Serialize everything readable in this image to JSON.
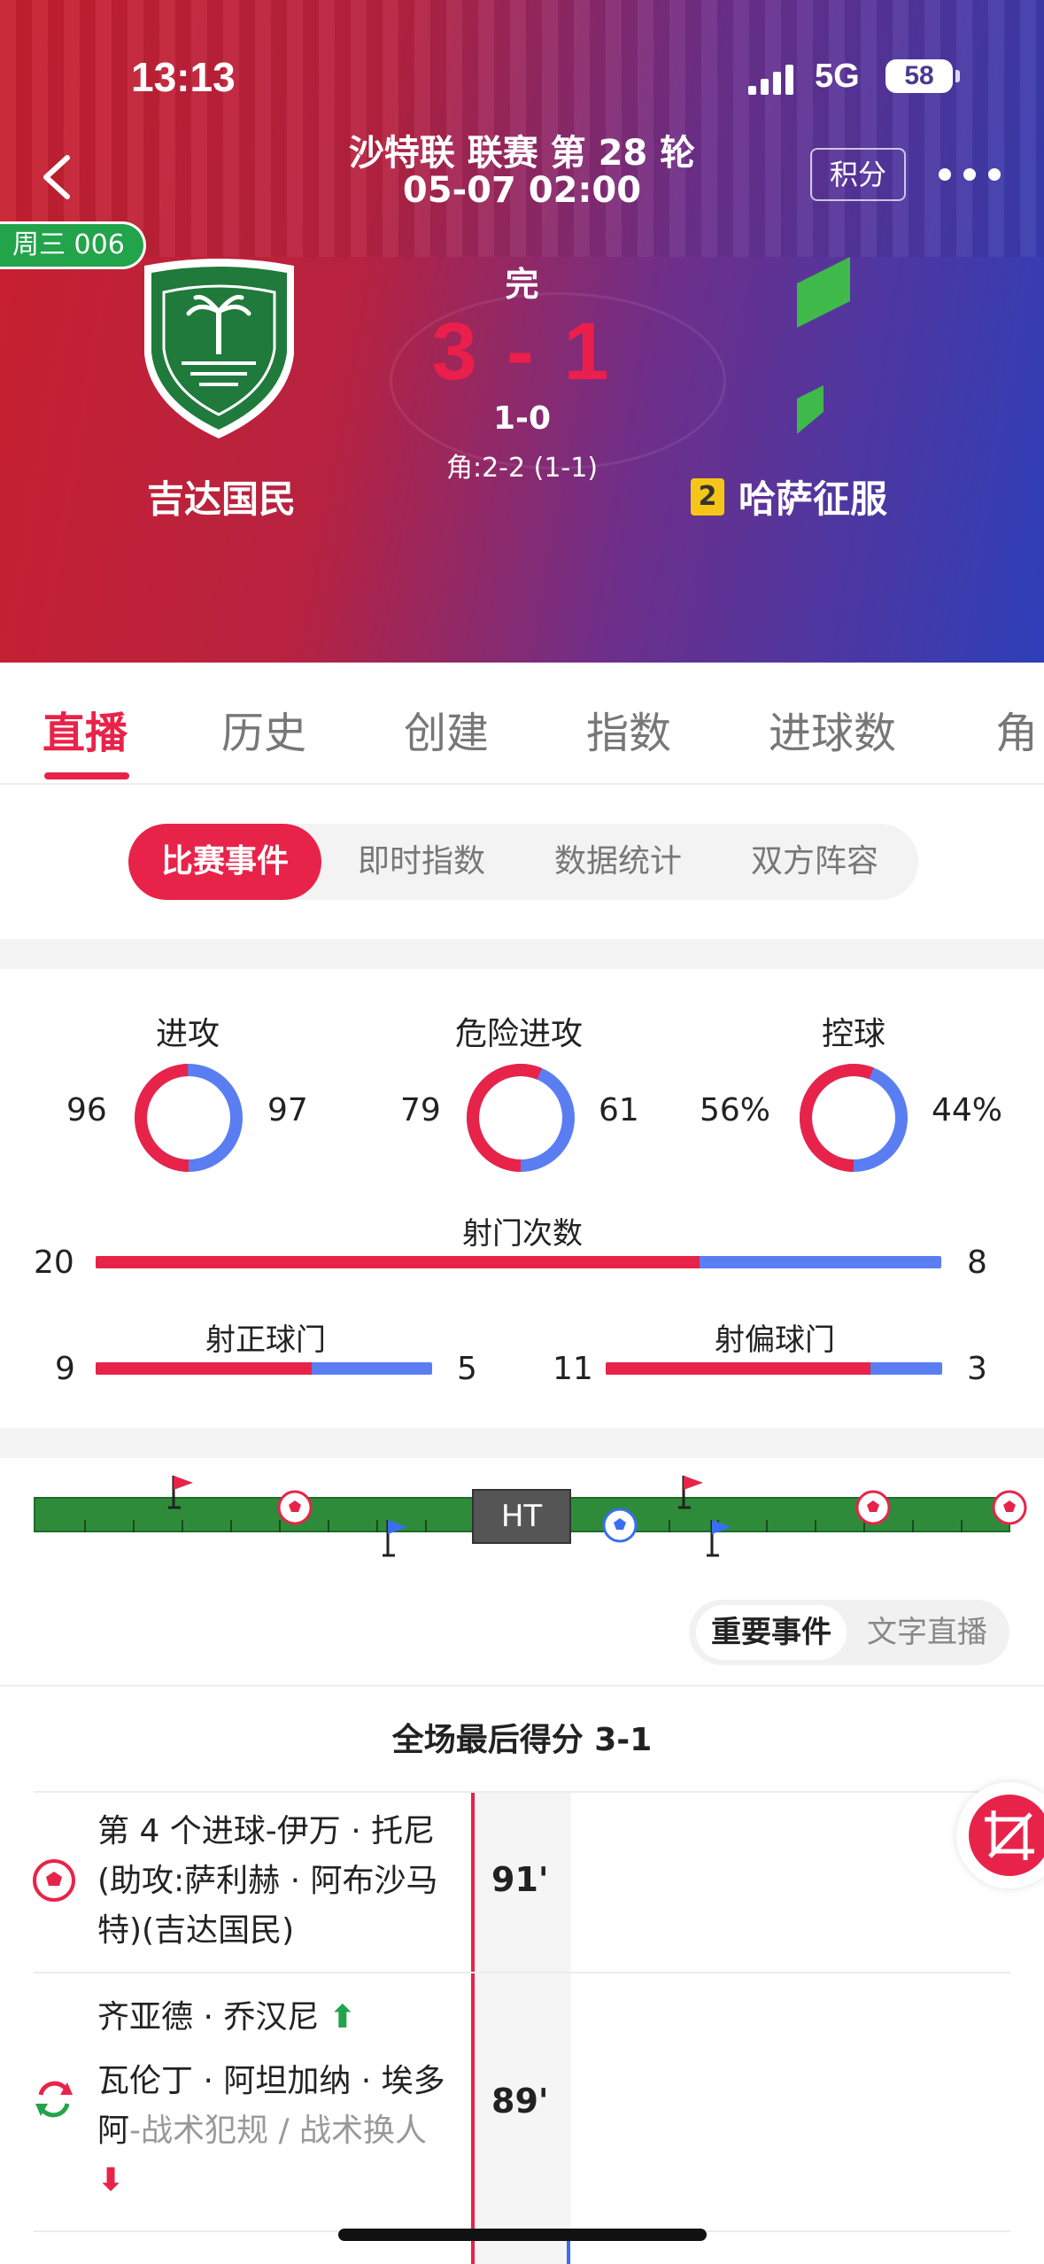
{
  "status_bar": {
    "time": "13:13",
    "network": "5G",
    "battery": "58"
  },
  "header": {
    "title_line1": "沙特联 联赛 第 28 轮",
    "title_line2": "05-07 02:00",
    "points_button": "积分",
    "week_badge": "周三 006",
    "home_team": "吉达国民",
    "away_team": "哈萨征服",
    "away_yellow_cards": "2",
    "match_status": "完",
    "score": "3 - 1",
    "half_time_score": "1-0",
    "corners": "角:2-2 (1-1)",
    "colors": {
      "score": "#ea1f4b",
      "home_crest": "#1f7a3c",
      "away_logo": "#3fb94a"
    }
  },
  "tabs": [
    "直播",
    "历史",
    "创建",
    "指数",
    "进球数",
    "角"
  ],
  "active_tab": "直播",
  "segments": [
    "比赛事件",
    "即时指数",
    "数据统计",
    "双方阵容"
  ],
  "stats": {
    "rings": [
      {
        "label": "进攻",
        "home": "96",
        "away": "97",
        "home_fraction": 0.497
      },
      {
        "label": "危险进攻",
        "home": "79",
        "away": "61",
        "home_fraction": 0.564
      },
      {
        "label": "控球",
        "home": "56%",
        "away": "44%",
        "home_fraction": 0.56
      }
    ],
    "shots": {
      "label": "射门次数",
      "home": "20",
      "away": "8",
      "home_fraction": 0.714
    },
    "on_target": {
      "label": "射正球门",
      "home": "9",
      "away": "5",
      "home_fraction": 0.643
    },
    "off_target": {
      "label": "射偏球门",
      "home": "11",
      "away": "3",
      "home_fraction": 0.786
    }
  },
  "timeline": {
    "ht_label": "HT"
  },
  "event_toggle": [
    "重要事件",
    "文字直播"
  ],
  "final_score_label": "全场最后得分 3-1",
  "events": [
    {
      "text": "第 4 个进球-伊万 · 托尼(助攻:萨利赫 · 阿布沙马特)(吉达国民)",
      "minute": "91'",
      "icon": "goal-icon"
    },
    {
      "player_in": "齐亚德 · 乔汉尼",
      "player_out": "瓦伦丁 · 阿坦加纳 · 埃多阿",
      "reason": "-战术犯规 / 战术换人",
      "minute": "89'",
      "icon": "substitution-icon"
    }
  ]
}
